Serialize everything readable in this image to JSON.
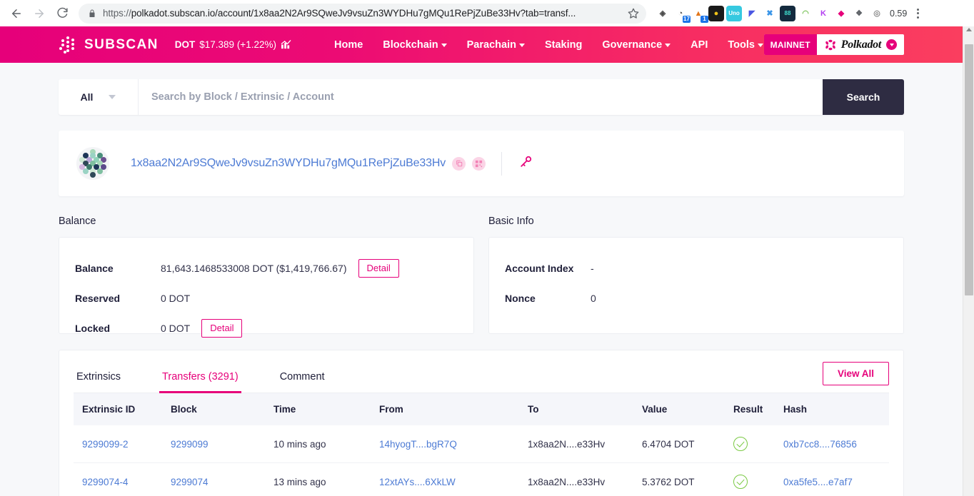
{
  "browser": {
    "back_icon": "back-arrow-icon",
    "forward_icon": "forward-arrow-icon",
    "reload_icon": "reload-icon",
    "lock_icon": "lock-icon",
    "url_scheme": "https://",
    "url_rest": "polkadot.subscan.io/account/1x8aa2N2Ar9SQweJv9vsuZn3WYDHu7gMQu1RePjZuBe33Hv?tab=transf...",
    "star_icon": "bookmark-star-icon",
    "profile_label": "0.59",
    "menu_icon": "kebab-menu-icon",
    "extensions": [
      {
        "name": "brave-shield-extension",
        "glyph": "◈",
        "bg": "#ffffff",
        "fg": "#4b4b4b",
        "badge": null
      },
      {
        "name": "ghost-tracker-extension",
        "glyph": "◔",
        "bg": "#ffffff",
        "fg": "#4b4b4b",
        "badge": "17"
      },
      {
        "name": "metamask-extension",
        "glyph": "▲",
        "bg": "#ffffff",
        "fg": "#e2761b",
        "badge": "1"
      },
      {
        "name": "keplr-extension",
        "glyph": "●",
        "bg": "#1a1a1a",
        "fg": "#f0c419",
        "badge": null
      },
      {
        "name": "uno-password-extension",
        "glyph": "Uno",
        "bg": "#36c9e0",
        "fg": "#ffffff",
        "badge": null
      },
      {
        "name": "subwallet-extension",
        "glyph": "◤",
        "bg": "#ffffff",
        "fg": "#4a56e2",
        "badge": null
      },
      {
        "name": "talisman-extension",
        "glyph": "✖",
        "bg": "#ffffff",
        "fg": "#3a95e8",
        "badge": null
      },
      {
        "name": "nightly-wallet-extension",
        "glyph": "88",
        "bg": "#132a3e",
        "fg": "#40e0d0",
        "badge": null
      },
      {
        "name": "leaf-extension",
        "glyph": "◠",
        "bg": "#ffffff",
        "fg": "#78c257",
        "badge": null
      },
      {
        "name": "kodadot-extension",
        "glyph": "K",
        "bg": "#ffffff",
        "fg": "#b23df0",
        "badge": null
      },
      {
        "name": "enkrypt-extension",
        "glyph": "◆",
        "bg": "#ffffff",
        "fg": "#e6007a",
        "badge": null
      },
      {
        "name": "puzzle-extensions-icon",
        "glyph": "❖",
        "bg": "#ffffff",
        "fg": "#5f6368",
        "badge": null
      },
      {
        "name": "screenshot-extension",
        "glyph": "◎",
        "bg": "#ffffff",
        "fg": "#8a8a8a",
        "badge": null
      }
    ]
  },
  "header": {
    "logo_icon": "subscan-logo-icon",
    "brand": "SUBSCAN",
    "token_symbol": "DOT",
    "token_price": "$17.389 (+1.22%)",
    "sparkline_icon": "price-chart-icon",
    "nav": [
      {
        "label": "Home",
        "has_caret": false
      },
      {
        "label": "Blockchain",
        "has_caret": true
      },
      {
        "label": "Parachain",
        "has_caret": true
      },
      {
        "label": "Staking",
        "has_caret": false
      },
      {
        "label": "Governance",
        "has_caret": true
      },
      {
        "label": "API",
        "has_caret": false
      },
      {
        "label": "Tools",
        "has_caret": true
      }
    ],
    "network_tag": "MAINNET",
    "network_name": "Polkadot",
    "network_logo_icon": "polkadot-logo-icon",
    "network_chevron_icon": "chevron-down-icon",
    "brand_color": "#e6007a",
    "gradient_end_color": "#fa3e5f"
  },
  "search": {
    "filter_value": "All",
    "filter_chevron_icon": "chevron-down-icon",
    "placeholder": "Search by Block / Extrinsic / Account",
    "value": "",
    "button_label": "Search",
    "button_color": "#2e2c42"
  },
  "account": {
    "identicon_name": "account-identicon",
    "address": "1x8aa2N2Ar9SQweJv9vsuZn3WYDHu7gMQu1RePjZuBe33Hv",
    "copy_icon": "copy-icon",
    "qr_icon": "qr-code-icon",
    "key_icon": "public-key-icon"
  },
  "balance_panel": {
    "title": "Balance",
    "rows": [
      {
        "key": "Balance",
        "value": "81,643.1468533008 DOT  ($1,419,766.67)",
        "button": "Detail"
      },
      {
        "key": "Reserved",
        "value": "0 DOT",
        "button": null
      },
      {
        "key": "Locked",
        "value": "0 DOT",
        "button": "Detail"
      }
    ]
  },
  "basic_info_panel": {
    "title": "Basic Info",
    "rows": [
      {
        "key": "Account Index",
        "value": "-",
        "button": null
      },
      {
        "key": "Nonce",
        "value": "0",
        "button": null
      }
    ]
  },
  "tabs": {
    "items": [
      {
        "label": "Extrinsics",
        "active": false
      },
      {
        "label": "Transfers (3291)",
        "active": true
      },
      {
        "label": "Comment",
        "active": false
      }
    ],
    "view_all_label": "View All"
  },
  "transfers_table": {
    "columns": [
      "Extrinsic ID",
      "Block",
      "Time",
      "From",
      "To",
      "Value",
      "Result",
      "Hash"
    ],
    "rows": [
      {
        "extrinsic_id": "9299099-2",
        "block": "9299099",
        "time": "10 mins ago",
        "from": "14hyogT....bgR7Q",
        "arrow_icon": "transfer-arrow-icon",
        "to": "1x8aa2N....e33Hv",
        "value": "6.4704 DOT",
        "result_icon": "success-check-icon",
        "hash": "0xb7cc8....76856"
      },
      {
        "extrinsic_id": "9299074-4",
        "block": "9299074",
        "time": "13 mins ago",
        "from": "12xtAYs....6XkLW",
        "arrow_icon": "transfer-arrow-icon",
        "to": "1x8aa2N....e33Hv",
        "value": "5.3762 DOT",
        "result_icon": "success-check-icon",
        "hash": "0xa5fe5....e7af7"
      }
    ]
  },
  "scrollbar": {
    "up_arrow_icon": "scroll-up-arrow-icon"
  }
}
